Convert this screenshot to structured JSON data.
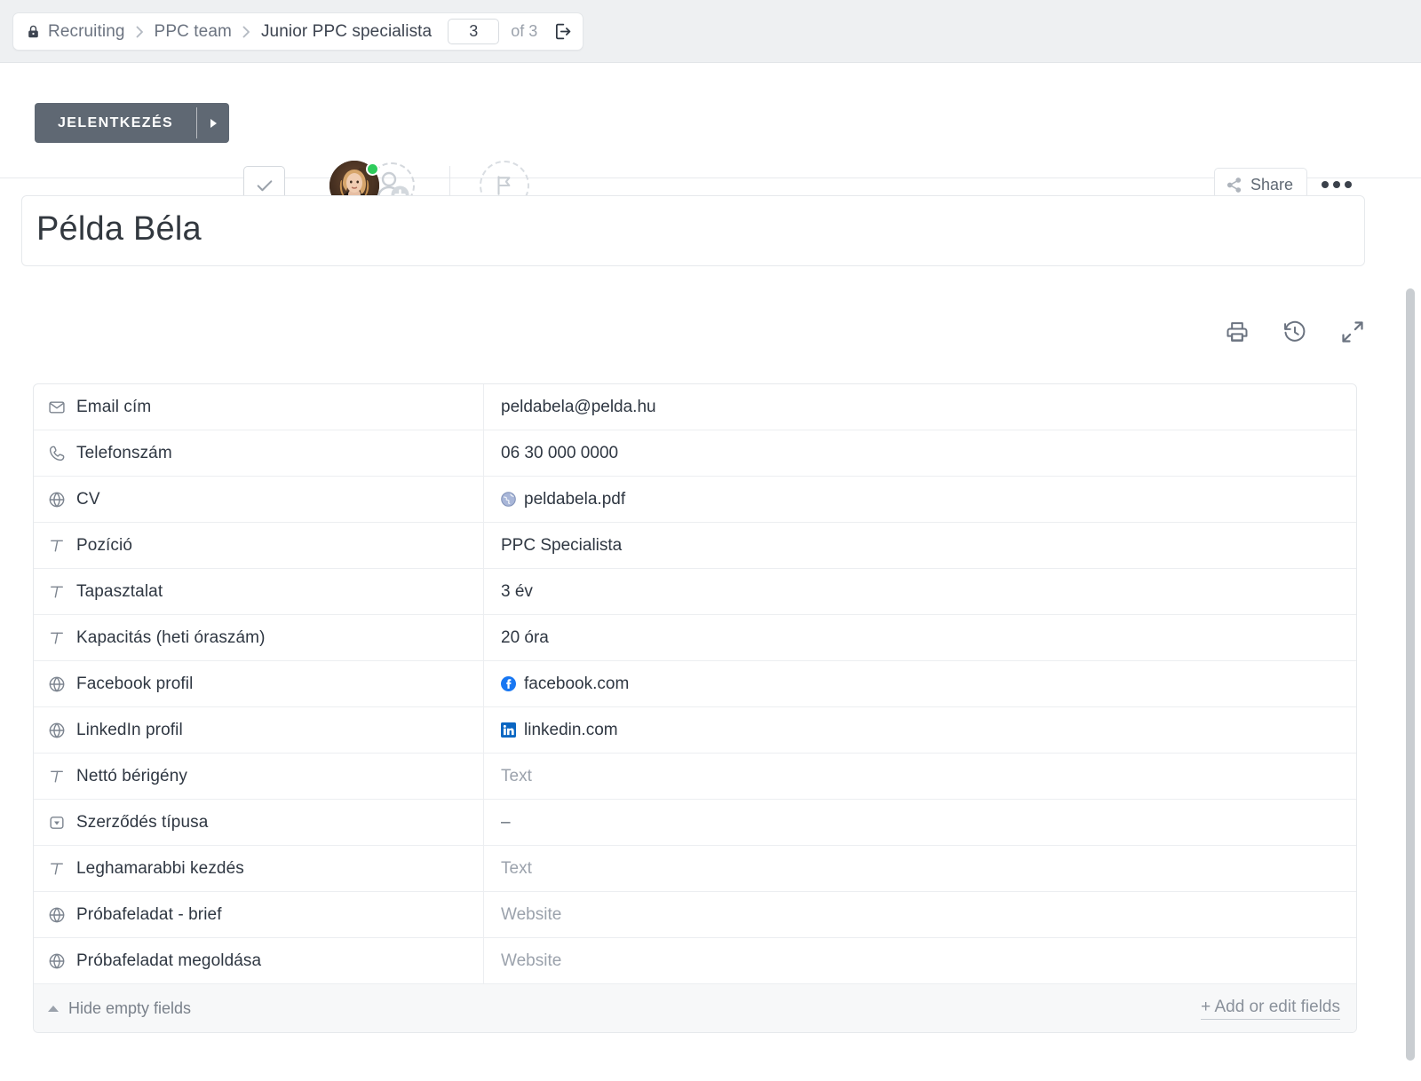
{
  "breadcrumb": {
    "lock_icon": "lock-icon",
    "items": [
      {
        "label": "Recruiting"
      },
      {
        "label": "PPC team"
      },
      {
        "label": "Junior PPC specialista"
      }
    ],
    "separator": "›",
    "page_number": "3",
    "of_label": "of 3",
    "export_icon": "open-in-new-icon"
  },
  "toolbar": {
    "apply_label": "JELENTKEZÉS",
    "apply_caret_icon": "caret-right-icon",
    "check_icon": "check-icon",
    "avatar_name": "assignee-avatar",
    "presence": "online",
    "add_person_icon": "add-person-icon",
    "flag_icon": "flag-icon",
    "share_label": "Share",
    "share_icon": "share-icon",
    "more_icon": "more-horizontal-icon"
  },
  "record": {
    "title": "Példa Béla",
    "actions": [
      {
        "name": "print-icon"
      },
      {
        "name": "history-icon"
      },
      {
        "name": "expand-icon"
      }
    ]
  },
  "fields": {
    "rows": [
      {
        "icon": "email-icon",
        "label": "Email cím",
        "value": "peldabela@pelda.hu",
        "empty": false,
        "favicon": ""
      },
      {
        "icon": "phone-icon",
        "label": "Telefonszám",
        "value": "06 30 000 0000",
        "empty": false,
        "favicon": ""
      },
      {
        "icon": "globe-icon",
        "label": "CV",
        "value": "peldabela.pdf",
        "empty": false,
        "favicon": "globe-favicon"
      },
      {
        "icon": "text-icon",
        "label": "Pozíció",
        "value": "PPC Specialista",
        "empty": false,
        "favicon": ""
      },
      {
        "icon": "text-icon",
        "label": "Tapasztalat",
        "value": "3 év",
        "empty": false,
        "favicon": ""
      },
      {
        "icon": "text-icon",
        "label": "Kapacitás (heti óraszám)",
        "value": "20 óra",
        "empty": false,
        "favicon": ""
      },
      {
        "icon": "globe-icon",
        "label": "Facebook profil",
        "value": "facebook.com",
        "empty": false,
        "favicon": "facebook-favicon"
      },
      {
        "icon": "globe-icon",
        "label": "LinkedIn profil",
        "value": "linkedin.com",
        "empty": false,
        "favicon": "linkedin-favicon"
      },
      {
        "icon": "text-icon",
        "label": "Nettó bérigény",
        "value": "Text",
        "empty": true,
        "favicon": ""
      },
      {
        "icon": "dropdown-icon",
        "label": "Szerződés típusa",
        "value": "–",
        "empty": false,
        "favicon": ""
      },
      {
        "icon": "text-icon",
        "label": "Leghamarabbi kezdés",
        "value": "Text",
        "empty": true,
        "favicon": ""
      },
      {
        "icon": "globe-icon",
        "label": "Próbafeladat - brief",
        "value": "Website",
        "empty": true,
        "favicon": ""
      },
      {
        "icon": "globe-icon",
        "label": "Próbafeladat megoldása",
        "value": "Website",
        "empty": true,
        "favicon": ""
      }
    ],
    "footer": {
      "hide_empty_label": "Hide empty fields",
      "collapse_icon": "triangle-up-icon",
      "add_fields_label": "+ Add or edit fields"
    }
  },
  "colors": {
    "accent": "#5f6873",
    "presence_online": "#2ecc5c",
    "facebook": "#1877f2",
    "linkedin": "#0a66c2",
    "page_bg": "#ffffff",
    "crumb_bar_bg": "#eef0f2"
  }
}
